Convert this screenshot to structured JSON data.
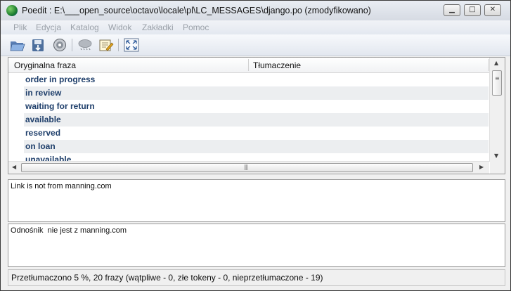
{
  "window": {
    "title": "Poedit : E:\\___open_source\\octavo\\locale\\pl\\LC_MESSAGES\\django.po (zmodyfikowano)",
    "controls": {
      "minimize": "▁",
      "maximize": "□",
      "close": "✕"
    }
  },
  "menu": [
    "Plik",
    "Edycja",
    "Katalog",
    "Widok",
    "Zakładki",
    "Pomoc"
  ],
  "toolbar": {
    "icons": [
      "open-folder-icon",
      "save-icon",
      "update-catalog-icon",
      "validate-icon",
      "comment-icon",
      "fullscreen-icon"
    ]
  },
  "list": {
    "columns": [
      "Oryginalna fraza",
      "Tłumaczenie"
    ],
    "rows": [
      {
        "source": "order in progress",
        "translation": ""
      },
      {
        "source": "in review",
        "translation": ""
      },
      {
        "source": "waiting for return",
        "translation": ""
      },
      {
        "source": "available",
        "translation": ""
      },
      {
        "source": "reserved",
        "translation": ""
      },
      {
        "source": "on loan",
        "translation": ""
      },
      {
        "source": "unavailable",
        "translation": ""
      }
    ]
  },
  "source_text": "Link is not from manning.com",
  "translation_text": "Odnośnik  nie jest z manning.com",
  "status": "Przetłumaczono 5 %, 20 frazy (wątpliwe - 0, złe tokeny - 0, nieprzetłumaczone - 19)",
  "colors": {
    "row_text": "#1f3f6b",
    "row_alt": "#eceef0",
    "menu_text": "#9aa0a8"
  }
}
